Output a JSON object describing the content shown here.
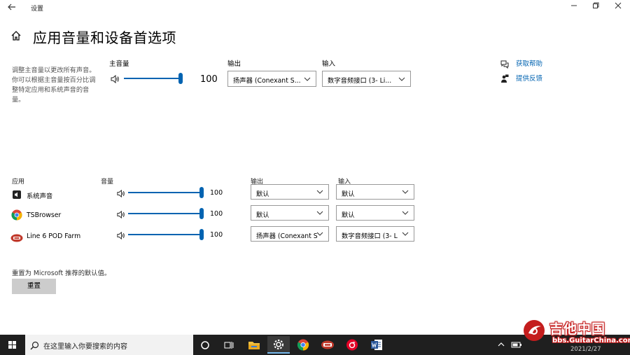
{
  "window": {
    "title": "设置"
  },
  "page": {
    "title": "应用音量和设备首选项",
    "description": "调整主音量以更改所有声音。你可以根据主音量按百分比调整特定应用和系统声音的音量。"
  },
  "master": {
    "label": "主音量",
    "volume": 100,
    "volume_text": "100",
    "output_label": "输出",
    "output_value": "扬声器 (Conexant S...",
    "input_label": "输入",
    "input_value": "数字音频接口 (3- Li..."
  },
  "help": {
    "get_help": "获取帮助",
    "feedback": "提供反馈"
  },
  "apps_header": {
    "app_label": "应用",
    "volume_label": "音量",
    "output_label": "输出",
    "input_label": "输入"
  },
  "apps": [
    {
      "name": "系统声音",
      "volume": 100,
      "volume_text": "100",
      "output": "默认",
      "input": "默认"
    },
    {
      "name": "TSBrowser",
      "volume": 100,
      "volume_text": "100",
      "output": "默认",
      "input": "默认"
    },
    {
      "name": "Line 6 POD Farm",
      "volume": 100,
      "volume_text": "100",
      "output": "扬声器 (Conexant S",
      "input": "数字音频接口 (3- L"
    }
  ],
  "reset": {
    "text": "重置为 Microsoft 推荐的默认值。",
    "button": "重置"
  },
  "taskbar": {
    "search_placeholder": "在这里输入你要搜索的内容"
  },
  "watermark": {
    "title": "吉他中国",
    "url": "bbs.GuitarChina.com",
    "date": "2021/2/27"
  },
  "colors": {
    "accent": "#0063b1",
    "taskbar": "#1f1f1f",
    "watermark_red": "#c41d1d"
  },
  "icons": {
    "back": "back-arrow-icon",
    "home": "home-icon",
    "speaker": "speaker-icon",
    "chevron": "chevron-down-icon"
  }
}
